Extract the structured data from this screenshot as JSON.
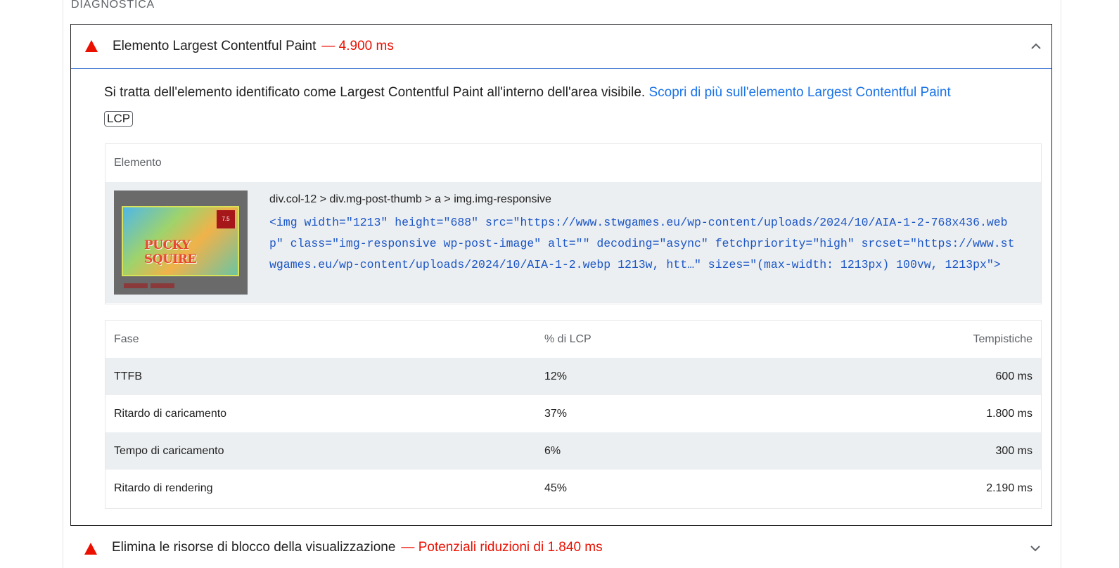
{
  "section": {
    "title": "DIAGNOSTICA"
  },
  "lcp_audit": {
    "title": "Elemento Largest Contentful Paint",
    "value": "— 4.900 ms",
    "description": "Si tratta dell'elemento identificato come Largest Contentful Paint all'interno dell'area visibile.",
    "learn_more": "Scopri di più sull'elemento Largest Contentful Paint",
    "badge": "LCP",
    "element_table": {
      "header": "Elemento",
      "thumbnail": {
        "title": "PUCKY SQUIRE",
        "score": "7.5"
      },
      "selector": "div.col-12 > div.mg-post-thumb > a > img.img-responsive",
      "snippet": "<img width=\"1213\" height=\"688\" src=\"https://www.stwgames.eu/wp-content/uploads/2024/10/AIA-1-2-768x436.webp\" class=\"img-responsive wp-post-image\" alt=\"\" decoding=\"async\" fetchpriority=\"high\" srcset=\"https://www.stwgames.eu/wp-content/uploads/2024/10/AIA-1-2.webp 1213w, htt…\" sizes=\"(max-width: 1213px) 100vw, 1213px\">"
    },
    "phase_table": {
      "headers": [
        "Fase",
        "% di LCP",
        "Tempistiche"
      ],
      "rows": [
        {
          "phase": "TTFB",
          "percent": "12%",
          "time": "600 ms"
        },
        {
          "phase": "Ritardo di caricamento",
          "percent": "37%",
          "time": "1.800 ms"
        },
        {
          "phase": "Tempo di caricamento",
          "percent": "6%",
          "time": "300 ms"
        },
        {
          "phase": "Ritardo di rendering",
          "percent": "45%",
          "time": "2.190 ms"
        }
      ]
    }
  },
  "next_audit": {
    "title": "Elimina le risorse di blocco della visualizzazione",
    "value": "— Potenziali riduzioni di 1.840 ms"
  },
  "colors": {
    "fail": "#eb0f00",
    "link": "#1a73e8",
    "code": "#1a55c6"
  },
  "icons": {
    "warning": "triangle-warning-icon",
    "expanded": "chevron-up-icon",
    "collapsed": "chevron-down-icon"
  }
}
